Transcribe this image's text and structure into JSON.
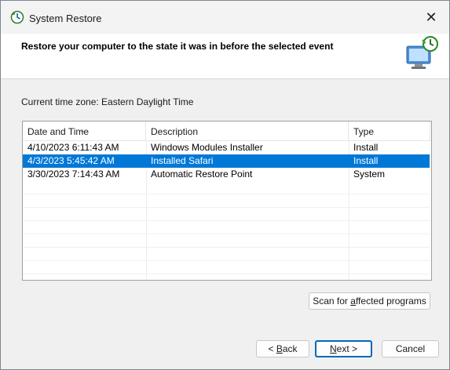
{
  "window": {
    "title": "System Restore",
    "close_glyph": "✕"
  },
  "header": {
    "instruction": "Restore your computer to the state it was in before the selected event"
  },
  "timezone_label": "Current time zone: Eastern Daylight Time",
  "table": {
    "columns": [
      "Date and Time",
      "Description",
      "Type"
    ],
    "rows": [
      {
        "date": "4/10/2023 6:11:43 AM",
        "description": "Windows Modules Installer",
        "type": "Install",
        "selected": false
      },
      {
        "date": "4/3/2023 5:45:42 AM",
        "description": "Installed Safari",
        "type": "Install",
        "selected": true
      },
      {
        "date": "3/30/2023 7:14:43 AM",
        "description": "Automatic Restore Point",
        "type": "System",
        "selected": false
      }
    ]
  },
  "buttons": {
    "scan": {
      "prefix": "Scan for ",
      "accel": "a",
      "suffix": "ffected programs"
    },
    "back": {
      "prefix": "< ",
      "accel": "B",
      "suffix": "ack"
    },
    "next": {
      "prefix": "",
      "accel": "N",
      "suffix": "ext >"
    },
    "cancel": "Cancel"
  },
  "icons": {
    "title": "system-restore-icon",
    "header": "system-restore-computer-icon"
  },
  "colors": {
    "selection": "#0078d7",
    "default_button_border": "#0067c0"
  }
}
